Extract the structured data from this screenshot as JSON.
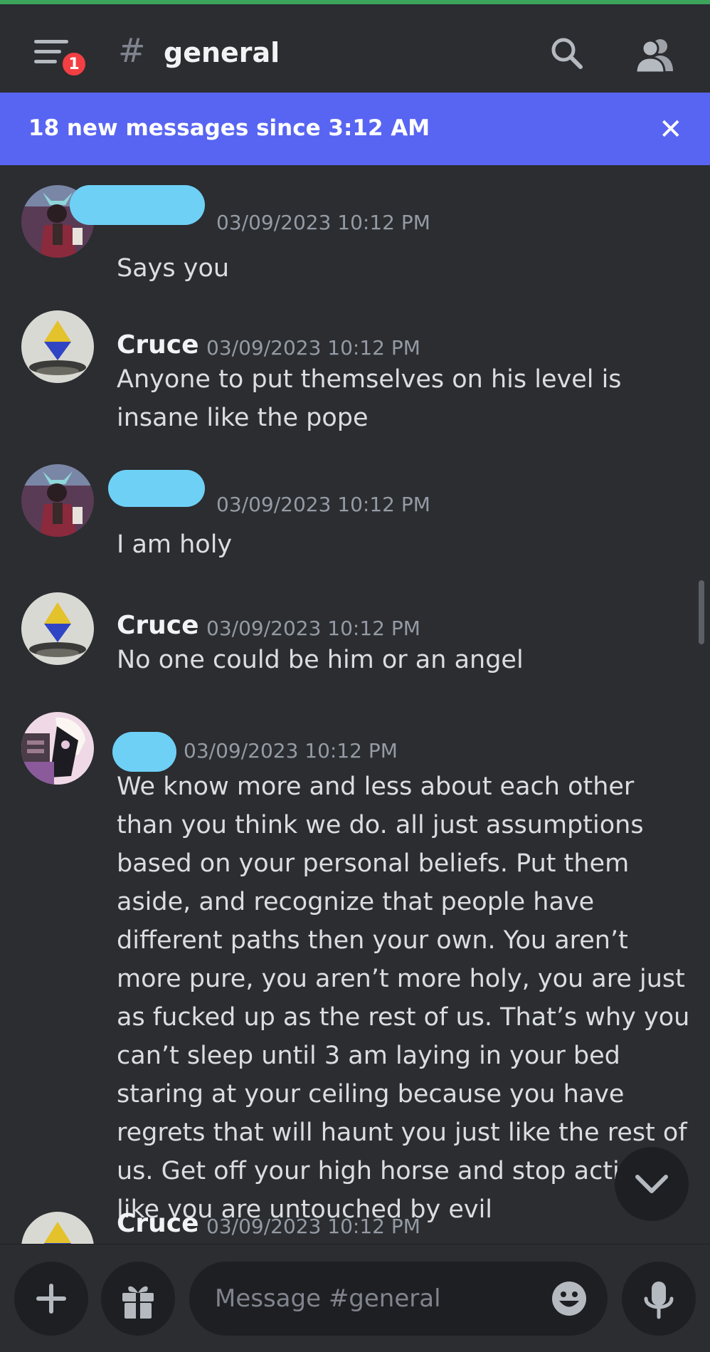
{
  "header": {
    "notification_count": "1",
    "channel_name": "general"
  },
  "banner": {
    "text": "18 new messages since 3:12 AM"
  },
  "messages": [
    {
      "author": "",
      "redacted": true,
      "timestamp": "03/09/2023 10:12 PM",
      "text": "Says you"
    },
    {
      "author": "Cruce",
      "redacted": false,
      "timestamp": "03/09/2023 10:12 PM",
      "text": "Anyone to put themselves on his level is insane like the pope"
    },
    {
      "author": "",
      "redacted": true,
      "timestamp": "03/09/2023 10:12 PM",
      "text": "I am holy"
    },
    {
      "author": "Cruce",
      "redacted": false,
      "timestamp": "03/09/2023 10:12 PM",
      "text": "No one could be him or an angel"
    },
    {
      "author": "",
      "redacted": true,
      "timestamp": "03/09/2023 10:12 PM",
      "text": "We know more and less about each other than you think we do. all just assumptions based on your personal beliefs. Put them aside, and recognize that people have different paths then your own. You aren’t more pure, you aren’t more holy, you are just as fucked up as the rest of us. That’s why you can’t sleep until 3 am laying in your bed staring at your ceiling because you have regrets that will haunt you just like the rest of us. Get off your high horse and stop acting like you are untouched by evil"
    },
    {
      "author": "Cruce",
      "redacted": false,
      "timestamp": "03/09/2023 10:12 PM",
      "text": ""
    }
  ],
  "composer": {
    "placeholder": "Message #general"
  },
  "colors": {
    "background": "#2b2d31",
    "banner": "#5865f2",
    "input": "#1e1f22",
    "redaction": "#6fd0f6",
    "badge": "#f23f43"
  },
  "icons": [
    "hamburger-menu-icon",
    "hash-icon",
    "search-icon",
    "members-icon",
    "close-icon",
    "chevron-down-icon",
    "plus-icon",
    "gift-icon",
    "emoji-icon",
    "microphone-icon"
  ]
}
